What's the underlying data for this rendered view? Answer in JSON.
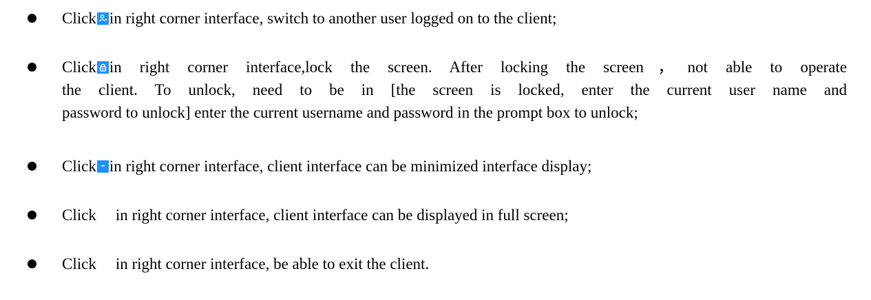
{
  "items": [
    {
      "click": "Click",
      "icon": "switch-user-icon",
      "text": "in right corner interface, switch to another user logged on to the client;"
    },
    {
      "click": "Click",
      "icon": "lock-icon",
      "lines": [
        "in right corner interface,lock the screen. After locking the screen，not able to operate",
        "the client. To unlock, need to be in [the screen is locked, enter the current user name and",
        "password to unlock] enter the current username and password in the prompt box to unlock;"
      ]
    },
    {
      "click": "Click",
      "icon": "minimize-icon",
      "text": "in right corner interface, client interface can be minimized interface display;"
    },
    {
      "click": "Click",
      "icon": "fullscreen-icon",
      "text": "in right corner interface, client interface can be displayed in full screen;"
    },
    {
      "click": "Click",
      "icon": "exit-icon",
      "text": "in right corner interface, be able to exit the client."
    }
  ],
  "colors": {
    "icon_background": "#1e90ff",
    "icon_glyph": "#ffffff",
    "text": "#000000"
  }
}
